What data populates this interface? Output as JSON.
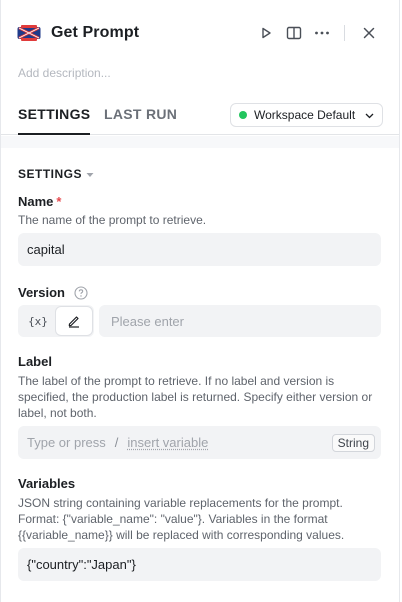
{
  "header": {
    "title": "Get Prompt",
    "description_placeholder": "Add description...",
    "logo_icon": "prompt-node-logo",
    "actions": [
      "play-icon",
      "split-view-icon",
      "more-icon",
      "close-icon"
    ]
  },
  "tabs": [
    {
      "label": "SETTINGS",
      "active": true
    },
    {
      "label": "LAST RUN",
      "active": false
    }
  ],
  "workspace": {
    "label": "Workspace Default",
    "status_color": "#22c55e"
  },
  "settings": {
    "section_title": "SETTINGS",
    "name": {
      "label": "Name",
      "required_mark": "*",
      "help": "The name of the prompt to retrieve.",
      "value": "capital"
    },
    "version": {
      "label": "Version",
      "toggle_variable": "{x}",
      "placeholder": "Please enter"
    },
    "label_field": {
      "label": "Label",
      "help": "The label of the prompt to retrieve. If no label and version is specified, the production label is returned. Specify either version or label, not both.",
      "placeholder_prefix": "Type or press",
      "placeholder_key": "/",
      "placeholder_link": "insert variable",
      "type_badge": "String"
    },
    "variables": {
      "label": "Variables",
      "help": "JSON string containing variable replacements for the prompt. Format: {\"variable_name\": \"value\"}. Variables in the format {{variable_name}} will be replaced with corresponding values.",
      "value": "{\"country\":\"Japan\"}"
    }
  }
}
